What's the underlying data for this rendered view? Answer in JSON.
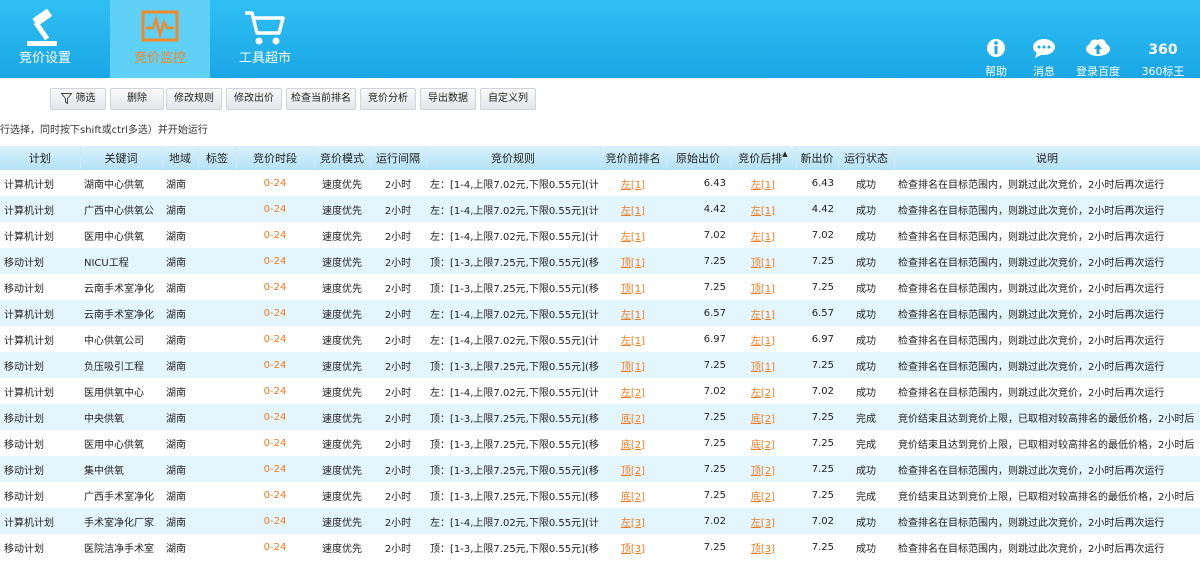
{
  "nav": {
    "tabs": [
      {
        "label": "竞价设置",
        "icon": "gavel-icon"
      },
      {
        "label": "竞价监控",
        "icon": "monitor-pulse-icon"
      },
      {
        "label": "工具超市",
        "icon": "shopping-cart-icon"
      }
    ],
    "active_tab": "竞价监控",
    "right": [
      {
        "label": "帮助",
        "icon": "info-icon"
      },
      {
        "label": "消息",
        "icon": "chat-bubble-icon"
      },
      {
        "label": "登录百度",
        "icon": "cloud-upload-icon"
      },
      {
        "label": "360标王",
        "icon_text": "360"
      }
    ]
  },
  "toolbar": {
    "buttons": [
      "筛选",
      "删除",
      "修改规则",
      "修改出价",
      "检查当前排名",
      "竞价分析",
      "导出数据",
      "自定义列"
    ]
  },
  "hint": "行选择，同时按下shift或ctrl多选）并开始运行",
  "table": {
    "columns": [
      "计划",
      "关键词",
      "地域",
      "标签",
      "竞价时段",
      "竞价模式",
      "运行间隔",
      "竞价规则",
      "竞价前排名",
      "原始出价",
      "竞价后排",
      "新出价",
      "运行状态",
      "说明"
    ],
    "sorted_column": "竞价后排",
    "rows": [
      [
        "计算机计划",
        "湖南中心供氧",
        "湖南",
        "",
        "0-24",
        "速度优先",
        "2小时",
        "左：[1-4,上限7.02元,下限0.55元](计",
        "左[1]",
        "6.43",
        "左[1]",
        "6.43",
        "成功",
        "检查排名在目标范围内，则跳过此次竞价，2小时后再次运行"
      ],
      [
        "计算机计划",
        "广西中心供氧公",
        "湖南",
        "",
        "0-24",
        "速度优先",
        "2小时",
        "左：[1-4,上限7.02元,下限0.55元](计",
        "左[1]",
        "4.42",
        "左[1]",
        "4.42",
        "成功",
        "检查排名在目标范围内，则跳过此次竞价，2小时后再次运行"
      ],
      [
        "计算机计划",
        "医用中心供氧",
        "湖南",
        "",
        "0-24",
        "速度优先",
        "2小时",
        "左：[1-4,上限7.02元,下限0.55元](计",
        "左[1]",
        "7.02",
        "左[1]",
        "7.02",
        "成功",
        "检查排名在目标范围内，则跳过此次竞价，2小时后再次运行"
      ],
      [
        "移动计划",
        "NICU工程",
        "湖南",
        "",
        "0-24",
        "速度优先",
        "2小时",
        "顶：[1-3,上限7.25元,下限0.55元](移",
        "顶[1]",
        "7.25",
        "顶[1]",
        "7.25",
        "成功",
        "检查排名在目标范围内，则跳过此次竞价，2小时后再次运行"
      ],
      [
        "移动计划",
        "云南手术室净化",
        "湖南",
        "",
        "0-24",
        "速度优先",
        "2小时",
        "顶：[1-3,上限7.25元,下限0.55元](移",
        "顶[1]",
        "7.25",
        "顶[1]",
        "7.25",
        "成功",
        "检查排名在目标范围内，则跳过此次竞价，2小时后再次运行"
      ],
      [
        "计算机计划",
        "云南手术室净化",
        "湖南",
        "",
        "0-24",
        "速度优先",
        "2小时",
        "左：[1-4,上限7.02元,下限0.55元](计",
        "左[1]",
        "6.57",
        "左[1]",
        "6.57",
        "成功",
        "检查排名在目标范围内，则跳过此次竞价，2小时后再次运行"
      ],
      [
        "计算机计划",
        "中心供氧公司",
        "湖南",
        "",
        "0-24",
        "速度优先",
        "2小时",
        "左：[1-4,上限7.02元,下限0.55元](计",
        "左[1]",
        "6.97",
        "左[1]",
        "6.97",
        "成功",
        "检查排名在目标范围内，则跳过此次竞价，2小时后再次运行"
      ],
      [
        "移动计划",
        "负压吸引工程",
        "湖南",
        "",
        "0-24",
        "速度优先",
        "2小时",
        "顶：[1-3,上限7.25元,下限0.55元](移",
        "顶[1]",
        "7.25",
        "顶[1]",
        "7.25",
        "成功",
        "检查排名在目标范围内，则跳过此次竞价，2小时后再次运行"
      ],
      [
        "计算机计划",
        "医用供氧中心",
        "湖南",
        "",
        "0-24",
        "速度优先",
        "2小时",
        "左：[1-4,上限7.02元,下限0.55元](计",
        "左[2]",
        "7.02",
        "左[2]",
        "7.02",
        "成功",
        "检查排名在目标范围内，则跳过此次竞价，2小时后再次运行"
      ],
      [
        "移动计划",
        "中央供氧",
        "湖南",
        "",
        "0-24",
        "速度优先",
        "2小时",
        "顶：[1-3,上限7.25元,下限0.55元](移",
        "底[2]",
        "7.25",
        "底[2]",
        "7.25",
        "完成",
        "竞价结束且达到竞价上限，已取相对较高排名的最低价格，2小时后"
      ],
      [
        "移动计划",
        "医用中心供氧",
        "湖南",
        "",
        "0-24",
        "速度优先",
        "2小时",
        "顶：[1-3,上限7.25元,下限0.55元](移",
        "底[2]",
        "7.25",
        "底[2]",
        "7.25",
        "完成",
        "竞价结束且达到竞价上限，已取相对较高排名的最低价格，2小时后"
      ],
      [
        "移动计划",
        "集中供氧",
        "湖南",
        "",
        "0-24",
        "速度优先",
        "2小时",
        "顶：[1-3,上限7.25元,下限0.55元](移",
        "顶[2]",
        "7.25",
        "顶[2]",
        "7.25",
        "成功",
        "检查排名在目标范围内，则跳过此次竞价，2小时后再次运行"
      ],
      [
        "移动计划",
        "广西手术室净化",
        "湖南",
        "",
        "0-24",
        "速度优先",
        "2小时",
        "顶：[1-3,上限7.25元,下限0.55元](移",
        "底[2]",
        "7.25",
        "底[2]",
        "7.25",
        "完成",
        "竞价结束且达到竞价上限，已取相对较高排名的最低价格，2小时后"
      ],
      [
        "计算机计划",
        "手术室净化厂家",
        "湖南",
        "",
        "0-24",
        "速度优先",
        "2小时",
        "左：[1-4,上限7.02元,下限0.55元](计",
        "左[3]",
        "7.02",
        "左[3]",
        "7.02",
        "成功",
        "检查排名在目标范围内，则跳过此次竞价，2小时后再次运行"
      ],
      [
        "移动计划",
        "医院洁净手术室",
        "湖南",
        "",
        "0-24",
        "速度优先",
        "2小时",
        "顶：[1-3,上限7.25元,下限0.55元](移",
        "顶[3]",
        "7.25",
        "顶[3]",
        "7.25",
        "成功",
        "检查排名在目标范围内，则跳过此次竞价，2小时后再次运行"
      ]
    ]
  },
  "colors": {
    "topbar": "#1aa6e6",
    "active_tab_text": "#f08a2a",
    "rank_text": "#f07a1f",
    "row_alt": "#e3f6fd"
  }
}
